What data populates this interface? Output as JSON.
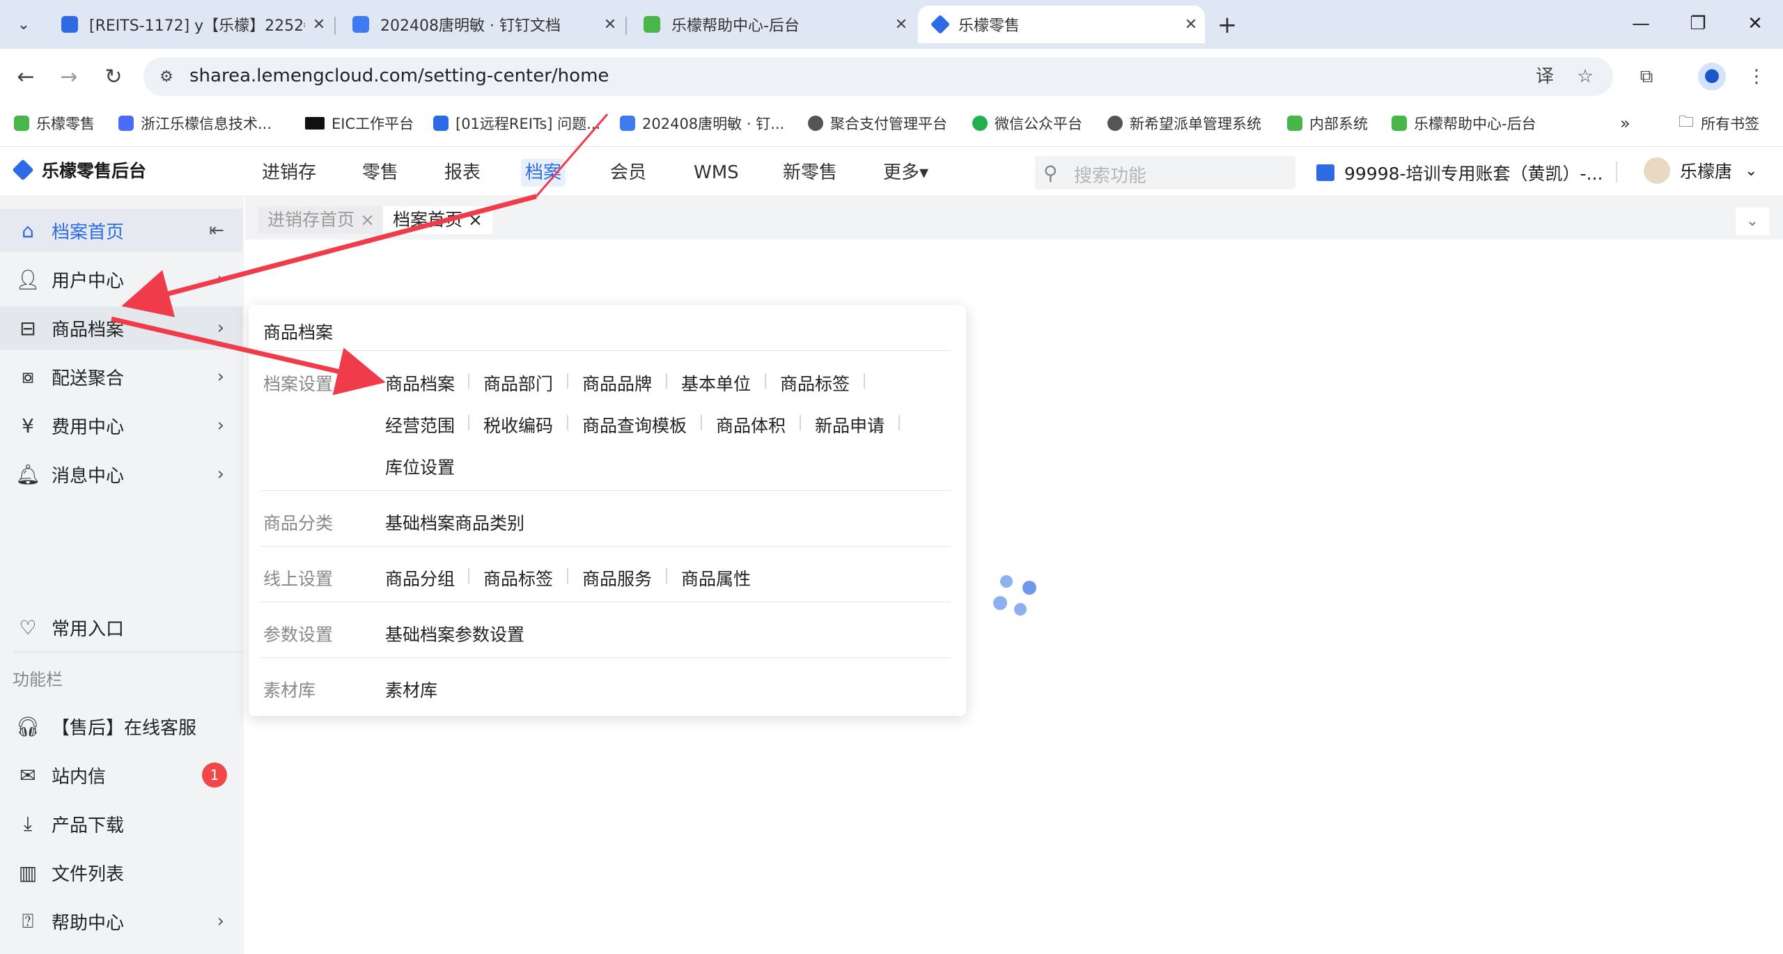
{
  "browser": {
    "tabs": [
      {
        "title": "[REITS-1172] y【乐檬】2252€",
        "color": "#2d6ae3"
      },
      {
        "title": "202408唐明敏 · 钉钉文档",
        "color": "#3f7bf0"
      },
      {
        "title": "乐檬帮助中心-后台",
        "color": "#49b649"
      },
      {
        "title": "乐檬零售",
        "color": "#2d6ae3"
      }
    ],
    "new_tab": "+",
    "url": "sharea.lemengcloud.com/setting-center/home",
    "bookmarks": [
      {
        "label": "乐檬零售",
        "color": "#49b649"
      },
      {
        "label": "浙江乐檬信息技术...",
        "color": "#4a6cf7"
      },
      {
        "label": "EIC工作平台",
        "color": "#111111"
      },
      {
        "label": "[01远程REITs] 问题...",
        "color": "#2d6ae3"
      },
      {
        "label": "202408唐明敏 · 钉...",
        "color": "#3f7bf0"
      },
      {
        "label": "聚合支付管理平台",
        "color": "#555555"
      },
      {
        "label": "微信公众平台",
        "color": "#22b14c"
      },
      {
        "label": "新希望派单管理系统",
        "color": "#555555"
      },
      {
        "label": "内部系统",
        "color": "#49b649"
      },
      {
        "label": "乐檬帮助中心-后台",
        "color": "#49b649"
      }
    ],
    "all_bookmarks": "所有书签"
  },
  "app": {
    "logo": "乐檬零售后台",
    "nav": [
      "进销存",
      "零售",
      "报表",
      "档案",
      "会员",
      "WMS",
      "新零售",
      "更多▾"
    ],
    "active_nav": "档案",
    "search_placeholder": "搜索功能",
    "account": "99998-培训专用账套（黄凯）-...",
    "user": "乐檬唐",
    "accent": "#2d6ae3"
  },
  "sidebar": {
    "items": [
      {
        "label": "档案首页",
        "icon": "home-icon"
      },
      {
        "label": "用户中心",
        "icon": "user-icon"
      },
      {
        "label": "商品档案",
        "icon": "product-icon"
      },
      {
        "label": "配送聚合",
        "icon": "delivery-icon"
      },
      {
        "label": "费用中心",
        "icon": "yen-icon"
      },
      {
        "label": "消息中心",
        "icon": "bell-icon"
      }
    ],
    "favorites": "常用入口",
    "section_title": "功能栏",
    "tools": [
      {
        "label": "【售后】在线客服",
        "icon": "headset-icon"
      },
      {
        "label": "站内信",
        "icon": "mail-icon"
      },
      {
        "label": "产品下载",
        "icon": "download-icon"
      },
      {
        "label": "文件列表",
        "icon": "chart-file-icon"
      },
      {
        "label": "帮助中心",
        "icon": "help-icon"
      }
    ],
    "unread_count": "1"
  },
  "content_tabs": [
    {
      "label": "进销存首页 ×"
    },
    {
      "label": "档案首页 ×"
    }
  ],
  "dropdown": {
    "header": "商品档案",
    "groups": [
      {
        "label": "档案设置",
        "items": [
          "商品档案",
          "商品部门",
          "商品品牌",
          "基本单位",
          "商品标签",
          "经营范围",
          "税收编码",
          "商品查询模板",
          "商品体积",
          "新品申请",
          "库位设置"
        ]
      },
      {
        "label": "商品分类",
        "items": [
          "基础档案商品类别"
        ]
      },
      {
        "label": "线上设置",
        "items": [
          "商品分组",
          "商品标签",
          "商品服务",
          "商品属性"
        ]
      },
      {
        "label": "参数设置",
        "items": [
          "基础档案参数设置"
        ]
      },
      {
        "label": "素材库",
        "items": [
          "素材库"
        ]
      }
    ]
  }
}
